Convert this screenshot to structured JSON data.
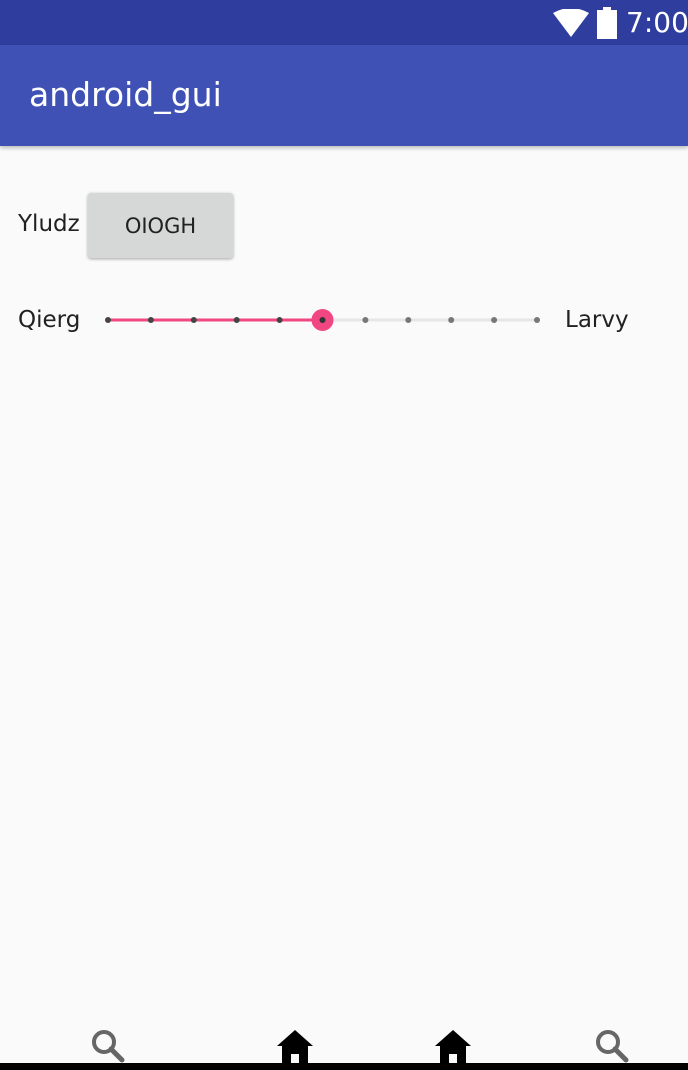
{
  "status_bar": {
    "time": "7:00",
    "icons": [
      "wifi-icon",
      "battery-icon"
    ],
    "color": "#2f3e9e"
  },
  "app_bar": {
    "title": "android_gui",
    "color": "#3f51b5"
  },
  "main": {
    "row1": {
      "label": "Yludz",
      "button_label": "OIOGH"
    },
    "row2": {
      "left_label": "Qierg",
      "right_label": "Larvy",
      "slider": {
        "max": 10,
        "value": 5,
        "accent_color": "#f04682"
      }
    }
  },
  "bottom_nav": {
    "icons": [
      "search-icon",
      "home-icon",
      "home-icon",
      "search-icon"
    ]
  }
}
